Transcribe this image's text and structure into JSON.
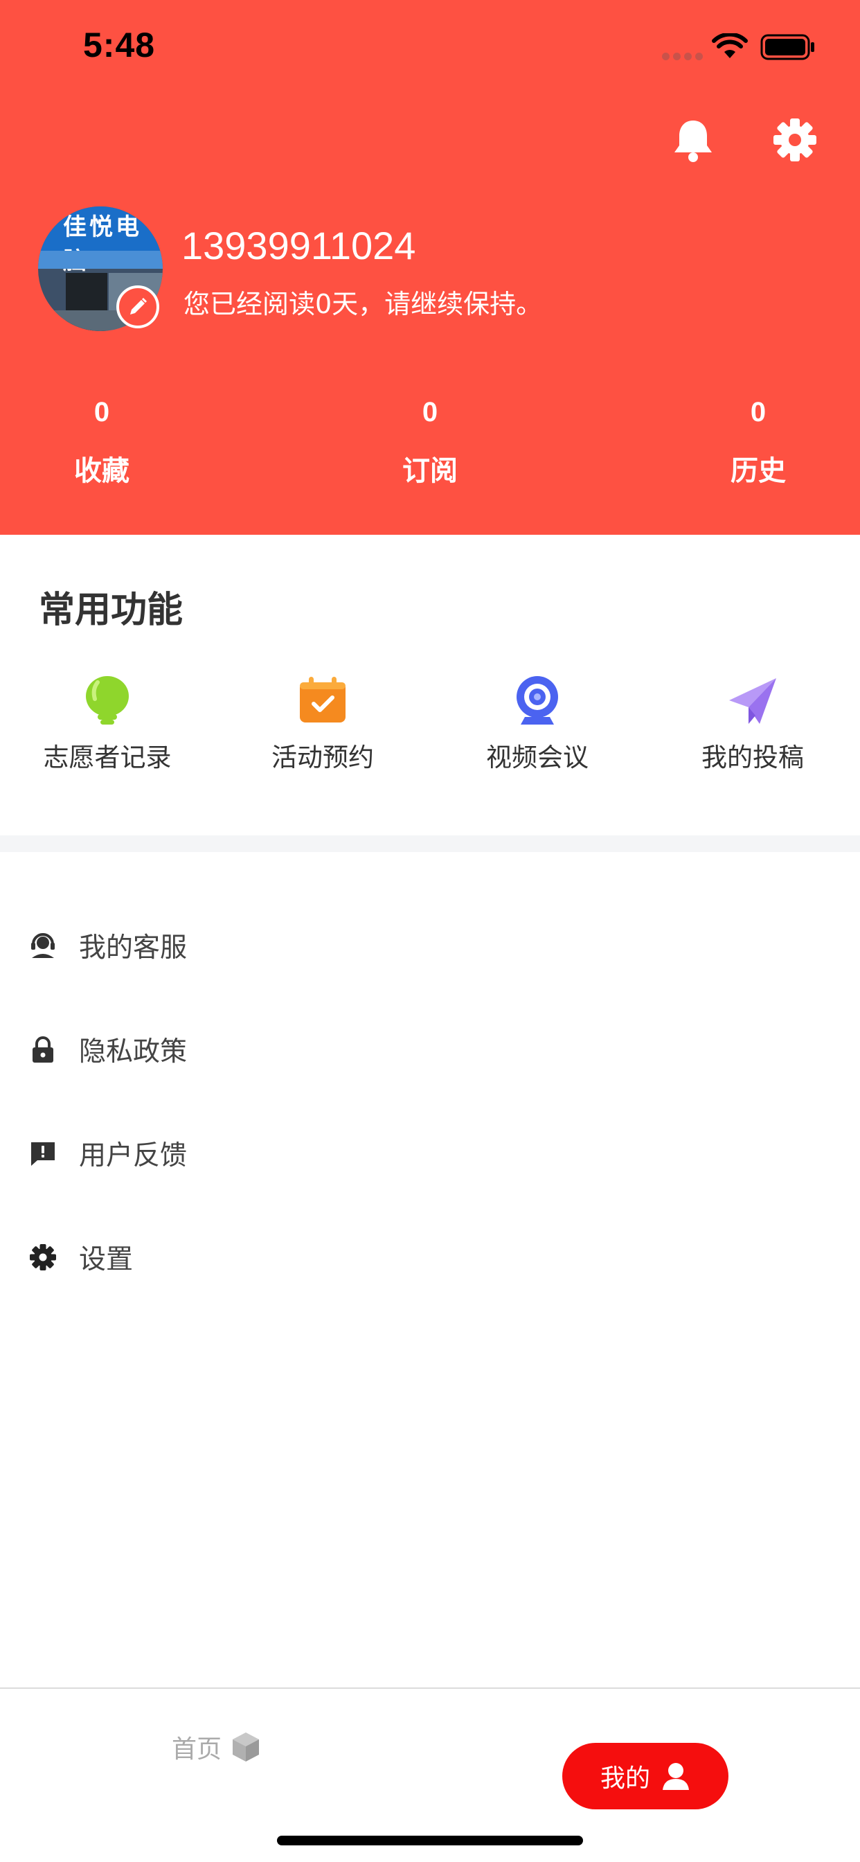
{
  "status_bar": {
    "time": "5:48"
  },
  "profile": {
    "phone": "13939911024",
    "reading_status": "您已经阅读0天，请继续保持。",
    "avatar_sign_text": "佳悦电脑"
  },
  "stats": [
    {
      "value": "0",
      "label": "收藏"
    },
    {
      "value": "0",
      "label": "订阅"
    },
    {
      "value": "0",
      "label": "历史"
    }
  ],
  "common_functions": {
    "title": "常用功能",
    "items": [
      {
        "label": "志愿者记录",
        "icon": "lightbulb-icon",
        "color": "#8fd62c"
      },
      {
        "label": "活动预约",
        "icon": "calendar-check-icon",
        "color": "#f58a1f"
      },
      {
        "label": "视频会议",
        "icon": "webcam-icon",
        "color": "#4b63f0"
      },
      {
        "label": "我的投稿",
        "icon": "paper-plane-icon",
        "color": "#a07cf2"
      }
    ]
  },
  "menu": [
    {
      "label": "我的客服",
      "icon": "customer-service-icon"
    },
    {
      "label": "隐私政策",
      "icon": "lock-icon"
    },
    {
      "label": "用户反馈",
      "icon": "feedback-icon"
    },
    {
      "label": "设置",
      "icon": "gear-icon"
    }
  ],
  "tabbar": {
    "home_label": "首页",
    "mine_label": "我的"
  },
  "colors": {
    "header_bg": "#fe5142",
    "active_tab": "#f50e0e"
  }
}
